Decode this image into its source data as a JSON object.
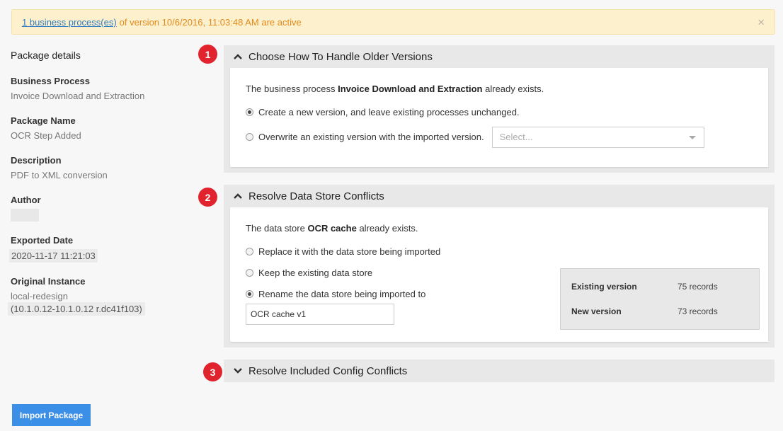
{
  "banner": {
    "link_text": "1 business process(es)",
    "message": "of version 10/6/2016, 11:03:48 AM are active",
    "close_symbol": "×"
  },
  "details": {
    "heading": "Package details",
    "business_process_label": "Business Process",
    "business_process_value": "Invoice Download and Extraction",
    "package_name_label": "Package Name",
    "package_name_value": "OCR Step Added",
    "description_label": "Description",
    "description_value": "PDF to XML conversion",
    "author_label": "Author",
    "exported_date_label": "Exported Date",
    "exported_date_value": "2020-11-17 11:21:03",
    "original_instance_label": "Original Instance",
    "original_instance_line1": "local-redesign",
    "original_instance_line2": "(10.1.0.12-10.1.0.12 r.dc41f103)"
  },
  "sections": [
    {
      "step": "1",
      "title": "Choose How To Handle Older Versions",
      "expanded": true,
      "intro_prefix": "The business process",
      "intro_bold": "Invoice Download and Extraction",
      "intro_suffix": "already exists.",
      "options": [
        {
          "label": "Create a new version, and leave existing processes unchanged.",
          "checked": true
        },
        {
          "label": "Overwrite an existing version with the imported version.",
          "checked": false
        }
      ],
      "select_placeholder": "Select..."
    },
    {
      "step": "2",
      "title": "Resolve Data Store Conflicts",
      "expanded": true,
      "intro_prefix": "The data store",
      "intro_bold": "OCR cache",
      "intro_suffix": "already exists.",
      "options": [
        {
          "label": "Replace it with the data store being imported",
          "checked": false
        },
        {
          "label": "Keep the existing data store",
          "checked": false
        },
        {
          "label": "Rename the data store being imported to",
          "checked": true
        }
      ],
      "rename_value": "OCR cache v1",
      "info": {
        "existing_label": "Existing version",
        "existing_value": "75 records",
        "new_label": "New version",
        "new_value": "73 records"
      }
    },
    {
      "step": "3",
      "title": "Resolve Included Config Conflicts",
      "expanded": false
    }
  ],
  "import_button": "Import Package",
  "colors": {
    "step_badge": "#e0232c",
    "banner_bg": "#fdf0cc",
    "banner_text": "#e48a1d",
    "primary_button": "#3b8fe6"
  }
}
